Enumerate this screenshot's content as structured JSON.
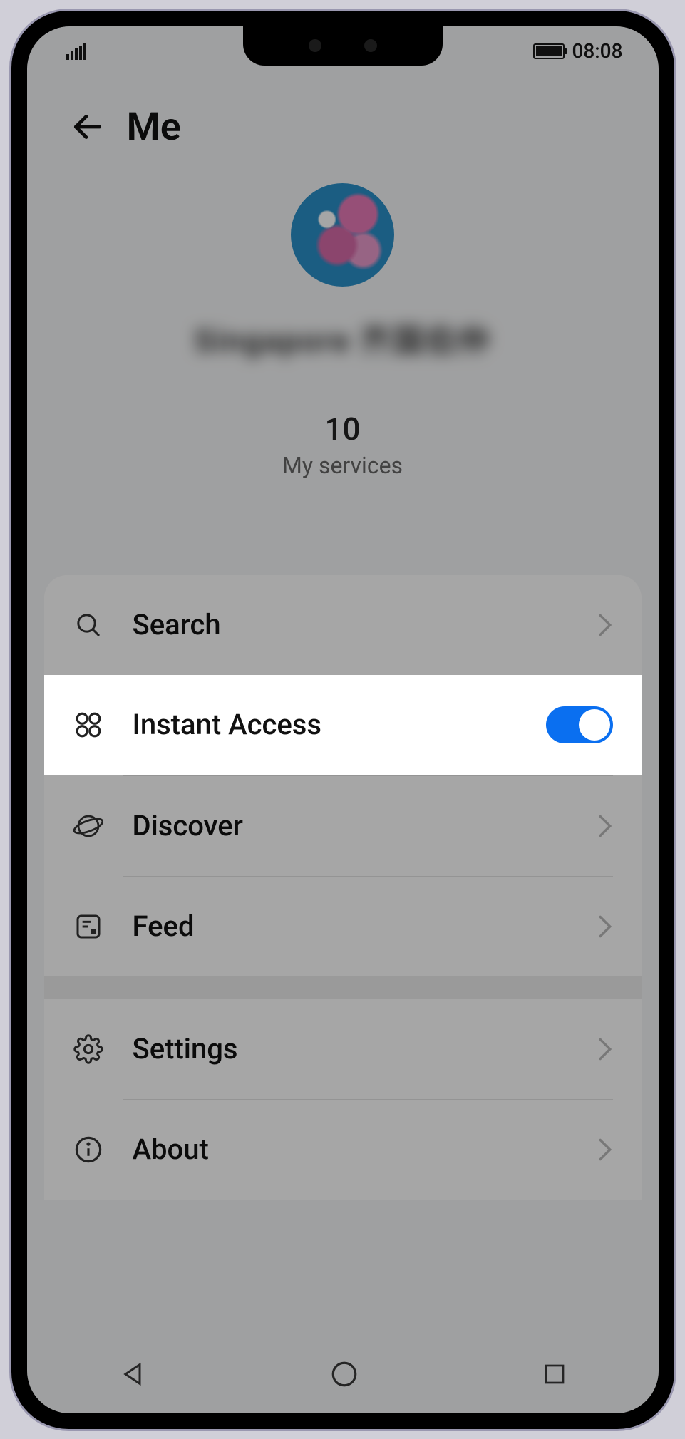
{
  "statusbar": {
    "time": "08:08"
  },
  "header": {
    "title": "Me"
  },
  "profile": {
    "username": "Singapore  齐国伯仲",
    "services_count": "10",
    "services_label": "My services"
  },
  "items": {
    "search": {
      "label": "Search"
    },
    "instant_access": {
      "label": "Instant Access",
      "toggle_on": true
    },
    "discover": {
      "label": "Discover"
    },
    "feed": {
      "label": "Feed"
    },
    "settings": {
      "label": "Settings"
    },
    "about": {
      "label": "About"
    }
  },
  "colors": {
    "accent": "#0a6ff0"
  }
}
